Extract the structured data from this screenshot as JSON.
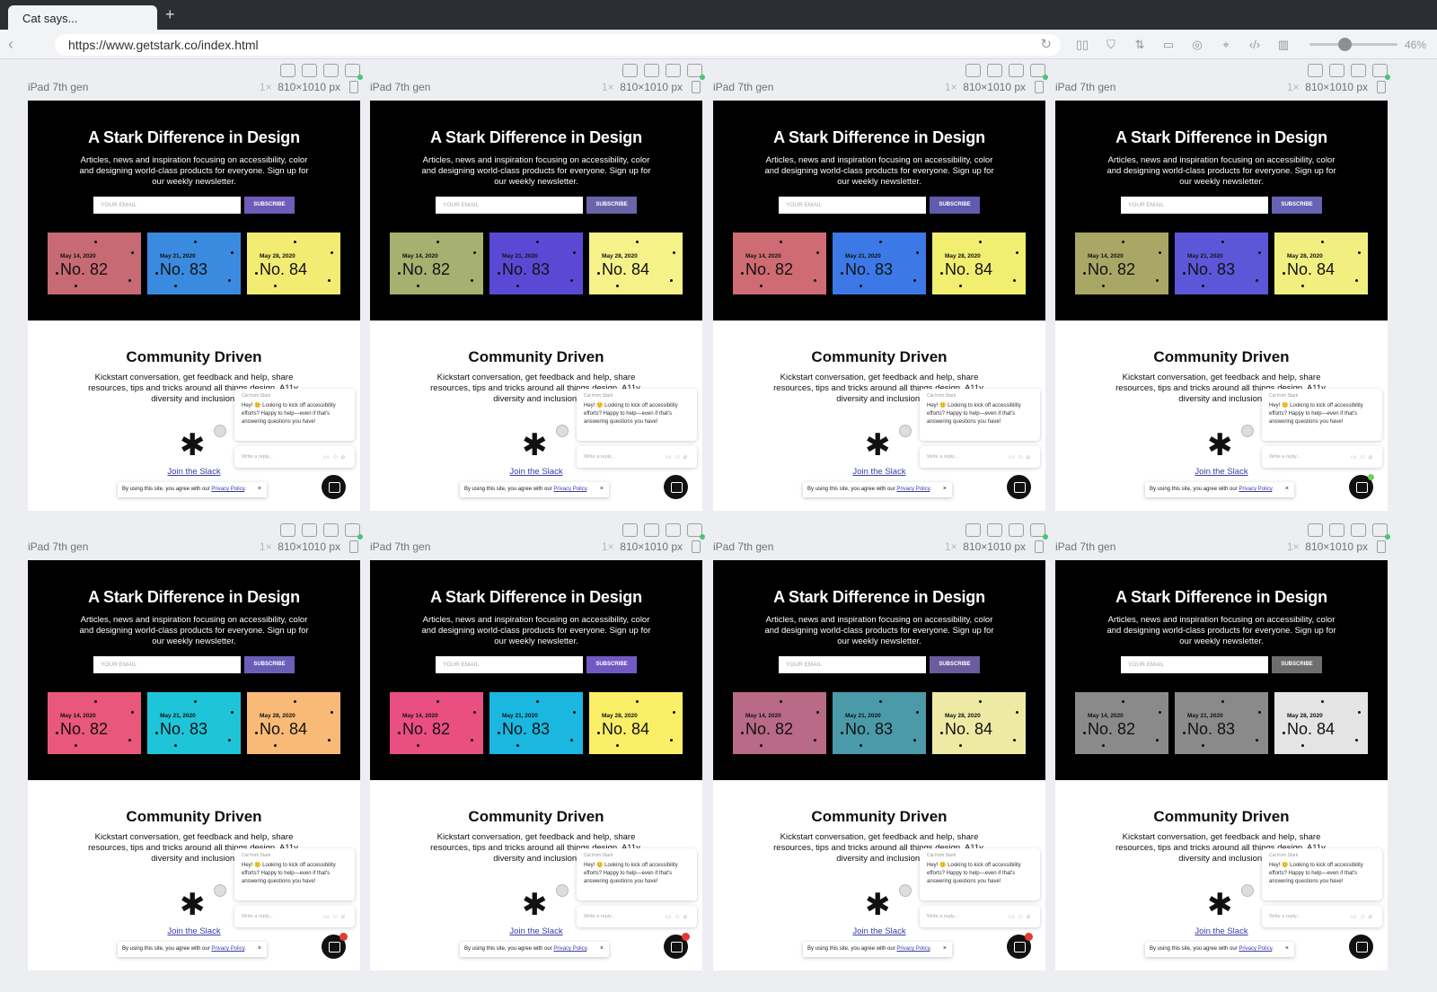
{
  "browser": {
    "tab_title": "Cat says...",
    "new_tab": "+",
    "url": "https://www.getstark.co/index.html",
    "zoom_label": "46%",
    "tool_icons": [
      "layout-icon",
      "filter-icon",
      "sort-icon",
      "devices-icon",
      "camera-icon",
      "inspect-icon",
      "code-icon",
      "sidebar-icon"
    ]
  },
  "device": {
    "name": "iPad 7th gen",
    "scale": "1×",
    "size": "810×1010 px"
  },
  "page": {
    "hero_title": "A Stark Difference in Design",
    "hero_text": "Articles, news and inspiration focusing on accessibility, color and designing world-class products for everyone. Sign up for our weekly newsletter.",
    "email_placeholder": "YOUR EMAIL",
    "subscribe_label": "SUBSCRIBE",
    "issues": [
      {
        "date": "May 14, 2020",
        "number": "No. 82"
      },
      {
        "date": "May 21, 2020",
        "number": "No. 83"
      },
      {
        "date": "May 28, 2020",
        "number": "No. 84"
      }
    ],
    "community_title": "Community Driven",
    "community_text": "Kickstart conversation, get feedback and help, share resources, tips and tricks around all things design, A11y, diversity and inclusion.",
    "slack_link": "Join the Slack",
    "chat_from": "Cat from Stark",
    "chat_message": "Hey! 🙂 Looking to kick off accessibility efforts? Happy to help—even if that's answering questions you have!",
    "reply_placeholder": "Write a reply...",
    "cookie_text": "By using this site, you agree with our ",
    "cookie_link": "Privacy Policy",
    "cookie_end": ".",
    "cookie_close": "×"
  },
  "variants": [
    {
      "issue_colors": [
        "#c86a73",
        "#3a8be0",
        "#f3ec72"
      ],
      "issue_text": [
        "#111",
        "#111",
        "#111"
      ],
      "subscribe_color": "#6e5cb8",
      "badge": "none"
    },
    {
      "issue_colors": [
        "#a6b070",
        "#5b49d6",
        "#f6f28a"
      ],
      "issue_text": [
        "#111",
        "#111",
        "#111"
      ],
      "subscribe_color": "#6a65a8",
      "badge": "none"
    },
    {
      "issue_colors": [
        "#cf6b73",
        "#3c79e6",
        "#f1ee72"
      ],
      "issue_text": [
        "#111",
        "#111",
        "#111"
      ],
      "subscribe_color": "#615bb0",
      "badge": "none"
    },
    {
      "issue_colors": [
        "#a8a766",
        "#5c57d8",
        "#f1ef80"
      ],
      "issue_text": [
        "#111",
        "#111",
        "#111"
      ],
      "subscribe_color": "#6763b4",
      "badge": "online"
    },
    {
      "issue_colors": [
        "#e9577a",
        "#1ec5d9",
        "#f9ba78"
      ],
      "issue_text": [
        "#111",
        "#111",
        "#111"
      ],
      "subscribe_color": "#6b5eb8",
      "badge": "notification"
    },
    {
      "issue_colors": [
        "#ea4f82",
        "#1ab7e0",
        "#fbef68"
      ],
      "issue_text": [
        "#111",
        "#111",
        "#111"
      ],
      "subscribe_color": "#7359c4",
      "badge": "notification"
    },
    {
      "issue_colors": [
        "#b86a86",
        "#4b9aaa",
        "#eeeaa4"
      ],
      "issue_text": [
        "#111",
        "#111",
        "#111"
      ],
      "subscribe_color": "#6a5d9e",
      "badge": "notification"
    },
    {
      "issue_colors": [
        "#8a8a8a",
        "#8a8a8a",
        "#e4e4e4"
      ],
      "issue_text": [
        "#111",
        "#111",
        "#111"
      ],
      "subscribe_color": "#6e6e6e",
      "badge": "none"
    }
  ]
}
